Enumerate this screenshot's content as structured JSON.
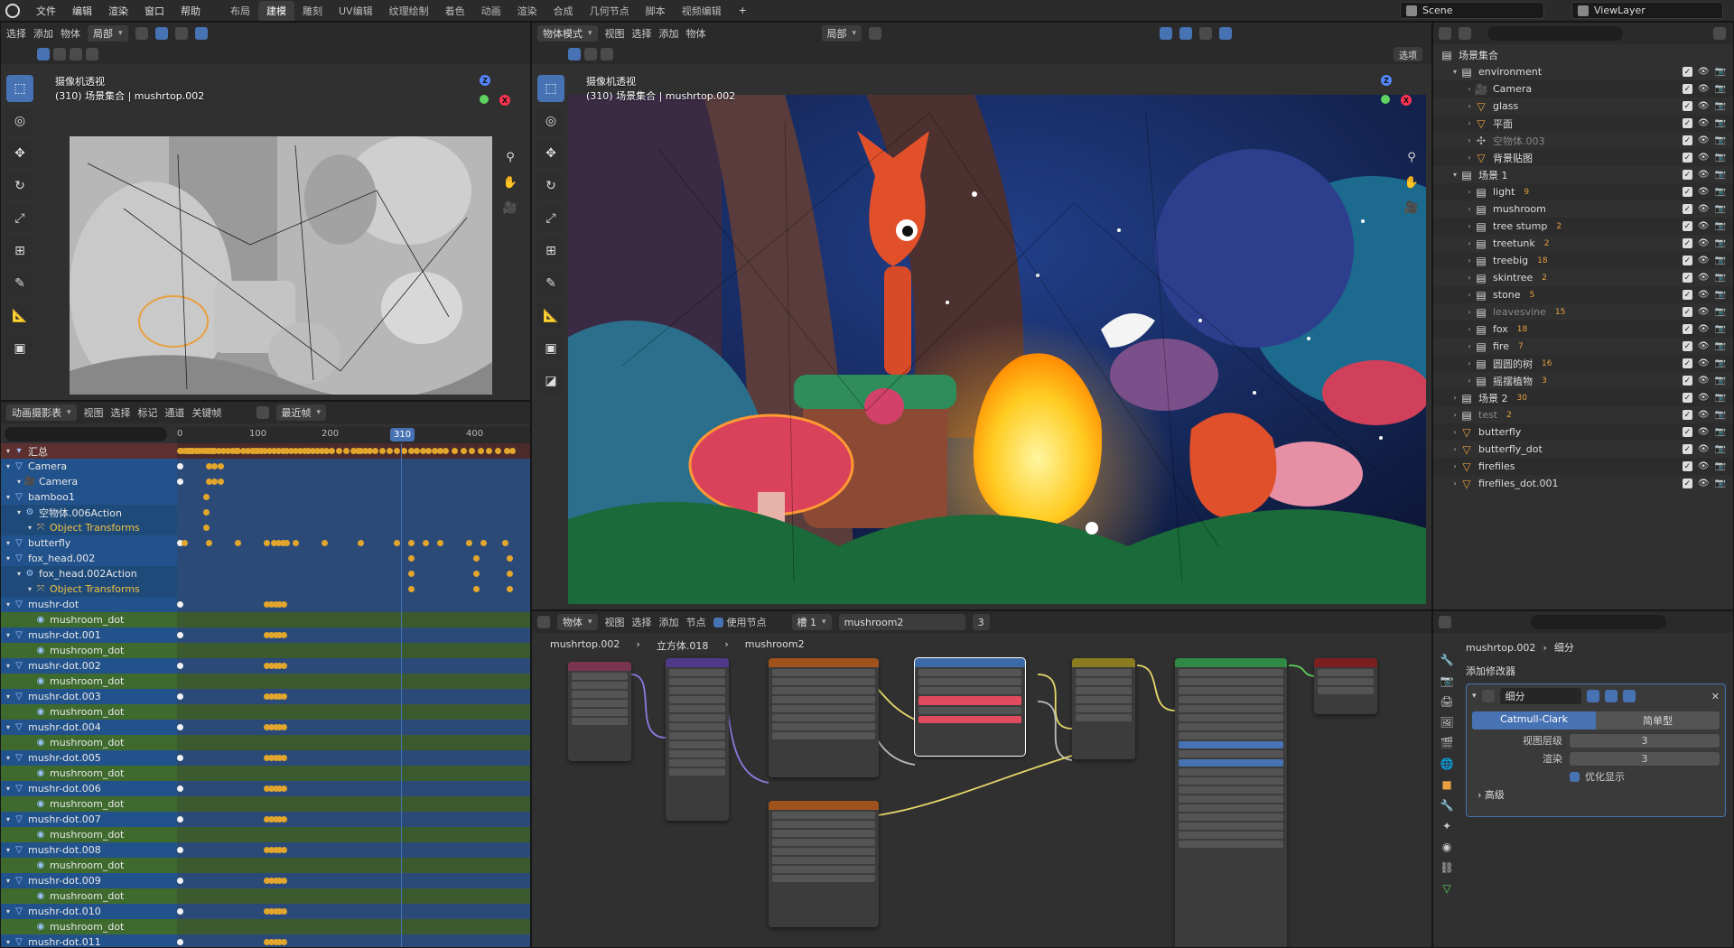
{
  "menu": {
    "items": [
      "文件",
      "编辑",
      "渲染",
      "窗口",
      "帮助"
    ],
    "workspaces": [
      "布局",
      "建模",
      "雕刻",
      "UV编辑",
      "纹理绘制",
      "着色",
      "动画",
      "渲染",
      "合成",
      "几何节点",
      "脚本",
      "视频编辑"
    ],
    "active_workspace": "建模",
    "add_tab": "+",
    "scene": "Scene",
    "view_layer": "ViewLayer"
  },
  "left_viewport": {
    "header": [
      "选择",
      "添加",
      "物体"
    ],
    "orientation": "局部",
    "overlay_title": "摄像机透视",
    "overlay_sub": "(310) 场景集合 | mushrtop.002"
  },
  "main_viewport": {
    "mode": "物体模式",
    "header": [
      "视图",
      "选择",
      "添加",
      "物体"
    ],
    "orientation": "局部",
    "select_label": "选项",
    "overlay_title": "摄像机透视",
    "overlay_sub": "(310) 场景集合 | mushrtop.002"
  },
  "dopesheet": {
    "editor": "动画摄影表",
    "header": [
      "视图",
      "选择",
      "标记",
      "通道",
      "关键帧"
    ],
    "filter": "最近帧",
    "current_frame": "310",
    "frame_ticks": [
      {
        "label": "0",
        "frame": 0
      },
      {
        "label": "100",
        "frame": 100
      },
      {
        "label": "200",
        "frame": 200
      },
      {
        "label": "400",
        "frame": 400
      }
    ],
    "channels": [
      {
        "label": "汇总",
        "level": 0,
        "kind": "summary",
        "keys": [
          0,
          3,
          7,
          10,
          12,
          14,
          16,
          18,
          22,
          24,
          28,
          32,
          36,
          40,
          44,
          46,
          48,
          54,
          60,
          66,
          72,
          78,
          80,
          88,
          94,
          100,
          104,
          108,
          112,
          118,
          124,
          130,
          136,
          142,
          148,
          154,
          160,
          166,
          172,
          178,
          184,
          190,
          196,
          202,
          210,
          220,
          230,
          240,
          246,
          250,
          256,
          262,
          270,
          280,
          290,
          300,
          310,
          320,
          328,
          336,
          344,
          352,
          360,
          368,
          380,
          392,
          404,
          416,
          428,
          440,
          452,
          460
        ]
      },
      {
        "label": "Camera",
        "level": 0,
        "kind": "obj",
        "keys": [
          0,
          40,
          48,
          56
        ]
      },
      {
        "label": "Camera",
        "level": 1,
        "kind": "cam",
        "keys": [
          0,
          40,
          48,
          56
        ]
      },
      {
        "label": "bamboo1",
        "level": 0,
        "kind": "obj",
        "keys": [
          36
        ]
      },
      {
        "label": "空物体.006Action",
        "level": 1,
        "kind": "action",
        "keys": [
          36
        ]
      },
      {
        "label": "Object Transforms",
        "level": 2,
        "kind": "group",
        "keys": [
          36
        ]
      },
      {
        "label": "butterfly",
        "level": 0,
        "kind": "obj",
        "keys": [
          0,
          6,
          40,
          80,
          120,
          130,
          136,
          142,
          148,
          160,
          200,
          250,
          300,
          320,
          340,
          360,
          400,
          420,
          450
        ]
      },
      {
        "label": "fox_head.002",
        "level": 0,
        "kind": "obj",
        "keys": [
          320,
          410,
          456
        ]
      },
      {
        "label": "fox_head.002Action",
        "level": 1,
        "kind": "action",
        "keys": [
          320,
          410,
          456
        ]
      },
      {
        "label": "Object Transforms",
        "level": 2,
        "kind": "group",
        "keys": [
          320,
          410,
          456
        ]
      },
      {
        "label": "mushr-dot",
        "level": 0,
        "kind": "obj",
        "keys": [
          0,
          120,
          126,
          132,
          138,
          144
        ]
      },
      {
        "label": "mushroom_dot",
        "level": 2,
        "kind": "mat",
        "keys": []
      },
      {
        "label": "mushr-dot.001",
        "level": 0,
        "kind": "obj",
        "keys": [
          0,
          120,
          126,
          132,
          138,
          144
        ]
      },
      {
        "label": "mushroom_dot",
        "level": 2,
        "kind": "mat",
        "keys": []
      },
      {
        "label": "mushr-dot.002",
        "level": 0,
        "kind": "obj",
        "keys": [
          0,
          120,
          126,
          132,
          138,
          144
        ]
      },
      {
        "label": "mushroom_dot",
        "level": 2,
        "kind": "mat",
        "keys": []
      },
      {
        "label": "mushr-dot.003",
        "level": 0,
        "kind": "obj",
        "keys": [
          0,
          120,
          126,
          132,
          138,
          144
        ]
      },
      {
        "label": "mushroom_dot",
        "level": 2,
        "kind": "mat",
        "keys": []
      },
      {
        "label": "mushr-dot.004",
        "level": 0,
        "kind": "obj",
        "keys": [
          0,
          120,
          126,
          132,
          138,
          144
        ]
      },
      {
        "label": "mushroom_dot",
        "level": 2,
        "kind": "mat",
        "keys": []
      },
      {
        "label": "mushr-dot.005",
        "level": 0,
        "kind": "obj",
        "keys": [
          0,
          120,
          126,
          132,
          138,
          144
        ]
      },
      {
        "label": "mushroom_dot",
        "level": 2,
        "kind": "mat",
        "keys": []
      },
      {
        "label": "mushr-dot.006",
        "level": 0,
        "kind": "obj",
        "keys": [
          0,
          120,
          126,
          132,
          138,
          144
        ]
      },
      {
        "label": "mushroom_dot",
        "level": 2,
        "kind": "mat",
        "keys": []
      },
      {
        "label": "mushr-dot.007",
        "level": 0,
        "kind": "obj",
        "keys": [
          0,
          120,
          126,
          132,
          138,
          144
        ]
      },
      {
        "label": "mushroom_dot",
        "level": 2,
        "kind": "mat",
        "keys": []
      },
      {
        "label": "mushr-dot.008",
        "level": 0,
        "kind": "obj",
        "keys": [
          0,
          120,
          126,
          132,
          138,
          144
        ]
      },
      {
        "label": "mushroom_dot",
        "level": 2,
        "kind": "mat",
        "keys": []
      },
      {
        "label": "mushr-dot.009",
        "level": 0,
        "kind": "obj",
        "keys": [
          0,
          120,
          126,
          132,
          138,
          144
        ]
      },
      {
        "label": "mushroom_dot",
        "level": 2,
        "kind": "mat",
        "keys": []
      },
      {
        "label": "mushr-dot.010",
        "level": 0,
        "kind": "obj",
        "keys": [
          0,
          120,
          126,
          132,
          138,
          144
        ]
      },
      {
        "label": "mushroom_dot",
        "level": 2,
        "kind": "mat",
        "keys": []
      },
      {
        "label": "mushr-dot.011",
        "level": 0,
        "kind": "obj",
        "keys": [
          0,
          120,
          126,
          132,
          138,
          144
        ]
      }
    ]
  },
  "outliner": {
    "root": "场景集合",
    "rows": [
      {
        "label": "environment",
        "level": 0,
        "type": "coll",
        "open": true
      },
      {
        "label": "Camera",
        "level": 1,
        "type": "cam"
      },
      {
        "label": "glass",
        "level": 1,
        "type": "mesh"
      },
      {
        "label": "平面",
        "level": 1,
        "type": "mesh"
      },
      {
        "label": "空物体.003",
        "level": 1,
        "type": "empty",
        "dim": true
      },
      {
        "label": "背景贴图",
        "level": 1,
        "type": "mesh"
      },
      {
        "label": "场景 1",
        "level": 0,
        "type": "coll",
        "open": true
      },
      {
        "label": "light",
        "level": 1,
        "type": "coll",
        "badge": "9"
      },
      {
        "label": "mushroom",
        "level": 1,
        "type": "coll"
      },
      {
        "label": "tree stump",
        "level": 1,
        "type": "coll",
        "badge": "2"
      },
      {
        "label": "treetunk",
        "level": 1,
        "type": "coll",
        "badge": "2"
      },
      {
        "label": "treebig",
        "level": 1,
        "type": "coll",
        "badge": "18"
      },
      {
        "label": "skintree",
        "level": 1,
        "type": "coll",
        "badge": "2"
      },
      {
        "label": "stone",
        "level": 1,
        "type": "coll",
        "badge": "5"
      },
      {
        "label": "leavesvine",
        "level": 1,
        "type": "coll",
        "badge": "15",
        "dim": true
      },
      {
        "label": "fox",
        "level": 1,
        "type": "coll",
        "badge": "18"
      },
      {
        "label": "fire",
        "level": 1,
        "type": "coll",
        "badge": "7"
      },
      {
        "label": "圆圆的树",
        "level": 1,
        "type": "coll",
        "badge": "16"
      },
      {
        "label": "摇摆植物",
        "level": 1,
        "type": "coll",
        "badge": "3"
      },
      {
        "label": "场景 2",
        "level": 0,
        "type": "coll",
        "badge": "30"
      },
      {
        "label": "test",
        "level": 0,
        "type": "coll",
        "badge": "2",
        "dim": true
      },
      {
        "label": "butterfly",
        "level": 0,
        "type": "mesh"
      },
      {
        "label": "butterfly_dot",
        "level": 0,
        "type": "mesh"
      },
      {
        "label": "firefiles",
        "level": 0,
        "type": "mesh"
      },
      {
        "label": "firefiles_dot.001",
        "level": 0,
        "type": "mesh"
      }
    ]
  },
  "node_editor": {
    "header": [
      "物体",
      "视图",
      "选择",
      "添加",
      "节点"
    ],
    "use_nodes": "使用节点",
    "slot": "槽 1",
    "material": "mushroom2",
    "users": "3",
    "breadcrumb": [
      "mushrtop.002",
      "立方体.018",
      "mushroom2"
    ]
  },
  "properties": {
    "breadcrumb": [
      "mushrtop.002",
      "细分"
    ],
    "add_modifier": "添加修改器",
    "modifier_name": "细分",
    "tab_catmull": "Catmull-Clark",
    "tab_simple": "简单型",
    "viewport_level_label": "视图层级",
    "viewport_level": "3",
    "render_label": "渲染",
    "render_level": "3",
    "optimal": "优化显示",
    "advanced": "高级"
  }
}
